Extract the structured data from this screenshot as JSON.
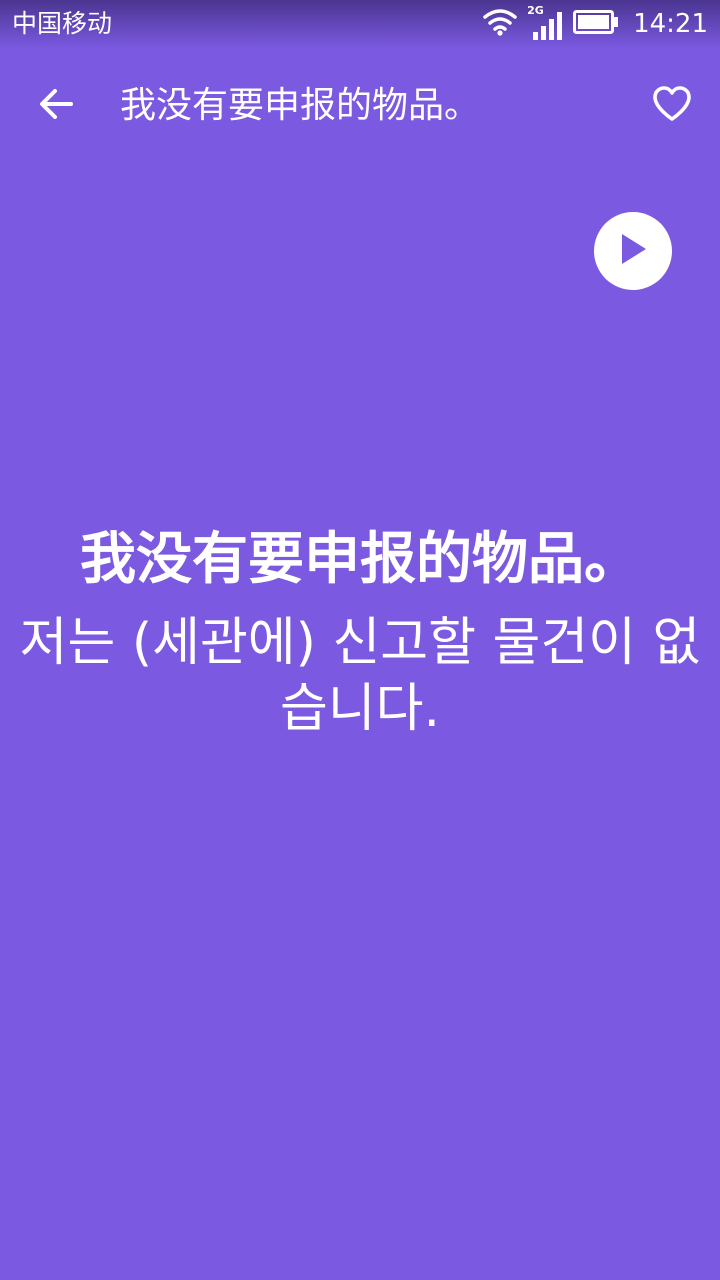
{
  "status_bar": {
    "carrier": "中国移动",
    "network_type": "2G",
    "time": "14:21",
    "icons": [
      "wifi-icon",
      "cellular-signal-icon",
      "battery-icon"
    ]
  },
  "app_bar": {
    "title": "我没有要申报的物品。",
    "back_icon": "arrow-left-icon",
    "favorite_icon": "heart-outline-icon"
  },
  "phrase": {
    "source_text": "我没有要申报的物品。",
    "translation_text": "저는 (세관에) 신고할 물건이 없습니다.",
    "play_icon": "play-icon"
  },
  "colors": {
    "background": "#7b59e0",
    "foreground": "#ffffff"
  }
}
